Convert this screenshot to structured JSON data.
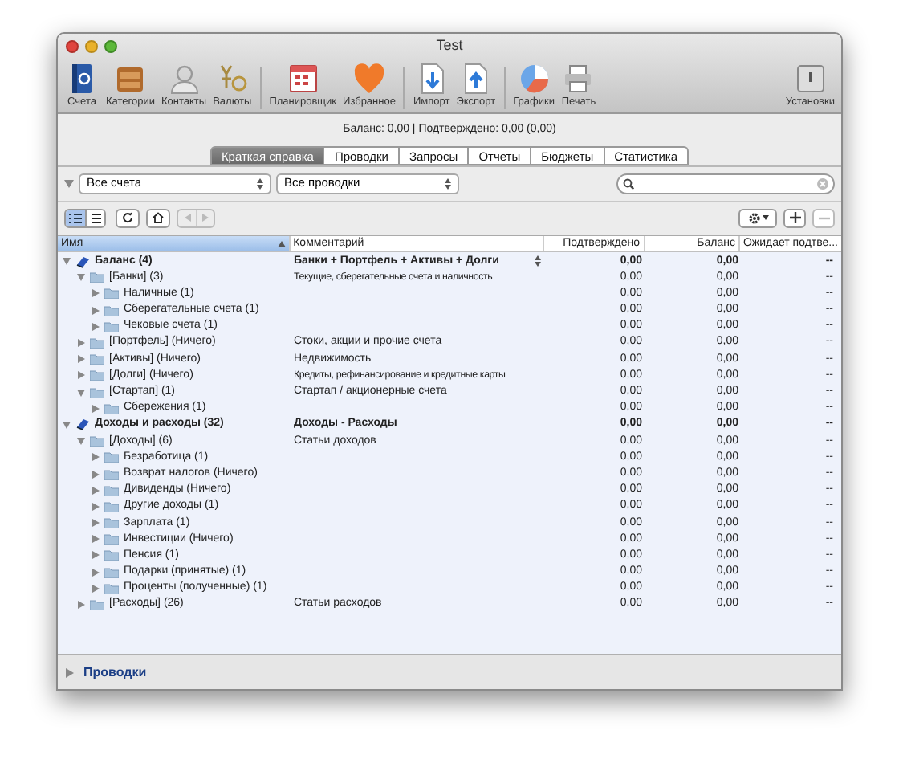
{
  "window": {
    "title": "Test"
  },
  "toolbar": [
    {
      "label": "Счета"
    },
    {
      "label": "Категории"
    },
    {
      "label": "Контакты"
    },
    {
      "label": "Валюты"
    },
    {
      "label": "Планировщик"
    },
    {
      "label": "Избранное"
    },
    {
      "label": "Импорт"
    },
    {
      "label": "Экспорт"
    },
    {
      "label": "Графики"
    },
    {
      "label": "Печать"
    },
    {
      "label": "Установки"
    }
  ],
  "summary": "Баланс: 0,00 | Подтверждено: 0,00 (0,00)",
  "tabs": [
    {
      "label": "Краткая справка",
      "selected": true
    },
    {
      "label": "Проводки",
      "selected": false
    },
    {
      "label": "Запросы",
      "selected": false
    },
    {
      "label": "Отчеты",
      "selected": false
    },
    {
      "label": "Бюджеты",
      "selected": false
    },
    {
      "label": "Статистика",
      "selected": false
    }
  ],
  "filters": {
    "accounts": "Все счета",
    "transactions": "Все проводки"
  },
  "view_buttons": [
    {
      "selected": true
    },
    {
      "selected": false
    }
  ],
  "table": {
    "columns": [
      "Имя",
      "Комментарий",
      "Подтверждено",
      "Баланс",
      "Ожидает подтве..."
    ],
    "rows": [
      {
        "kind": "group",
        "name": "Баланс (4)",
        "comment": "Банки + Портфель + Активы + Долги",
        "confirmed": "0,00",
        "balance": "0,00",
        "pending": "--",
        "expanded": true,
        "stepper": true,
        "children": [
          {
            "kind": "folder",
            "name": "[Банки] (3)",
            "comment": "Текущие, сберегательные счета и наличность",
            "confirmed": "0,00",
            "balance": "0,00",
            "pending": "--",
            "expanded": true,
            "children": [
              {
                "kind": "folder",
                "name": "Наличные (1)",
                "confirmed": "0,00",
                "balance": "0,00",
                "pending": "--",
                "expanded": false
              },
              {
                "kind": "folder",
                "name": "Сберегательные счета (1)",
                "confirmed": "0,00",
                "balance": "0,00",
                "pending": "--",
                "expanded": false
              },
              {
                "kind": "folder",
                "name": "Чековые счета (1)",
                "confirmed": "0,00",
                "balance": "0,00",
                "pending": "--",
                "expanded": false
              }
            ]
          },
          {
            "kind": "folder",
            "name": "[Портфель] (Ничего)",
            "comment": "Стоки, акции и прочие счета",
            "confirmed": "0,00",
            "balance": "0,00",
            "pending": "--",
            "expanded": false
          },
          {
            "kind": "folder",
            "name": "[Активы] (Ничего)",
            "comment": "Недвижимость",
            "confirmed": "0,00",
            "balance": "0,00",
            "pending": "--",
            "expanded": false
          },
          {
            "kind": "folder",
            "name": "[Долги] (Ничего)",
            "comment": "Кредиты, рефинансирование и кредитные карты",
            "confirmed": "0,00",
            "balance": "0,00",
            "pending": "--",
            "expanded": false
          },
          {
            "kind": "folder",
            "name": "[Стартап] (1)",
            "comment": "Стартап / акционерные счета",
            "confirmed": "0,00",
            "balance": "0,00",
            "pending": "--",
            "expanded": true,
            "children": [
              {
                "kind": "folder",
                "name": "Сбережения (1)",
                "confirmed": "0,00",
                "balance": "0,00",
                "pending": "--",
                "expanded": false
              }
            ]
          }
        ]
      },
      {
        "kind": "group",
        "name": "Доходы и расходы (32)",
        "comment": "Доходы - Расходы",
        "confirmed": "0,00",
        "balance": "0,00",
        "pending": "--",
        "expanded": true,
        "children": [
          {
            "kind": "folder",
            "name": "[Доходы] (6)",
            "comment": "Статьи доходов",
            "confirmed": "0,00",
            "balance": "0,00",
            "pending": "--",
            "expanded": true,
            "children": [
              {
                "kind": "folder",
                "name": "Безработица (1)",
                "confirmed": "0,00",
                "balance": "0,00",
                "pending": "--",
                "expanded": false
              },
              {
                "kind": "folder",
                "name": "Возврат налогов (Ничего)",
                "confirmed": "0,00",
                "balance": "0,00",
                "pending": "--",
                "expanded": false
              },
              {
                "kind": "folder",
                "name": "Дивиденды (Ничего)",
                "confirmed": "0,00",
                "balance": "0,00",
                "pending": "--",
                "expanded": false
              },
              {
                "kind": "folder",
                "name": "Другие доходы (1)",
                "confirmed": "0,00",
                "balance": "0,00",
                "pending": "--",
                "expanded": false
              },
              {
                "kind": "folder",
                "name": "Зарплата (1)",
                "confirmed": "0,00",
                "balance": "0,00",
                "pending": "--",
                "expanded": false
              },
              {
                "kind": "folder",
                "name": "Инвестиции (Ничего)",
                "confirmed": "0,00",
                "balance": "0,00",
                "pending": "--",
                "expanded": false
              },
              {
                "kind": "folder",
                "name": "Пенсия (1)",
                "confirmed": "0,00",
                "balance": "0,00",
                "pending": "--",
                "expanded": false
              },
              {
                "kind": "folder",
                "name": "Подарки (принятые) (1)",
                "confirmed": "0,00",
                "balance": "0,00",
                "pending": "--",
                "expanded": false
              },
              {
                "kind": "folder",
                "name": "Проценты (полученные) (1)",
                "confirmed": "0,00",
                "balance": "0,00",
                "pending": "--",
                "expanded": false
              }
            ]
          },
          {
            "kind": "folder",
            "name": "[Расходы] (26)",
            "comment": "Статьи расходов",
            "confirmed": "0,00",
            "balance": "0,00",
            "pending": "--",
            "expanded": false
          }
        ]
      }
    ]
  },
  "footer": {
    "label": "Проводки",
    "expanded": false
  }
}
